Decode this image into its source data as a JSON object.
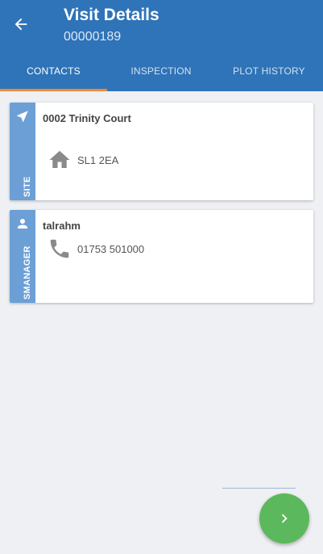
{
  "header": {
    "title": "Visit Details",
    "subtitle": "00000189",
    "background_color": "#2f73b8"
  },
  "tabs": [
    {
      "label": "CONTACTS",
      "active": true
    },
    {
      "label": "INSPECTION",
      "active": false
    },
    {
      "label": "PLOT HISTORY",
      "active": false
    }
  ],
  "cards": {
    "site": {
      "strip_label": "SITE",
      "strip_icon": "navigation-arrow-icon",
      "name": "0002 Trinity Court",
      "postcode_icon": "home-icon",
      "postcode": "SL1 2EA"
    },
    "manager": {
      "strip_label": "SMANAGER",
      "strip_icon": "person-icon",
      "name": "talrahm",
      "phone_icon": "phone-icon",
      "phone": "01753 501000"
    }
  },
  "fab": {
    "icon": "chevron-right-icon",
    "color": "#5cb85c"
  },
  "accent_color": "#f0883a"
}
